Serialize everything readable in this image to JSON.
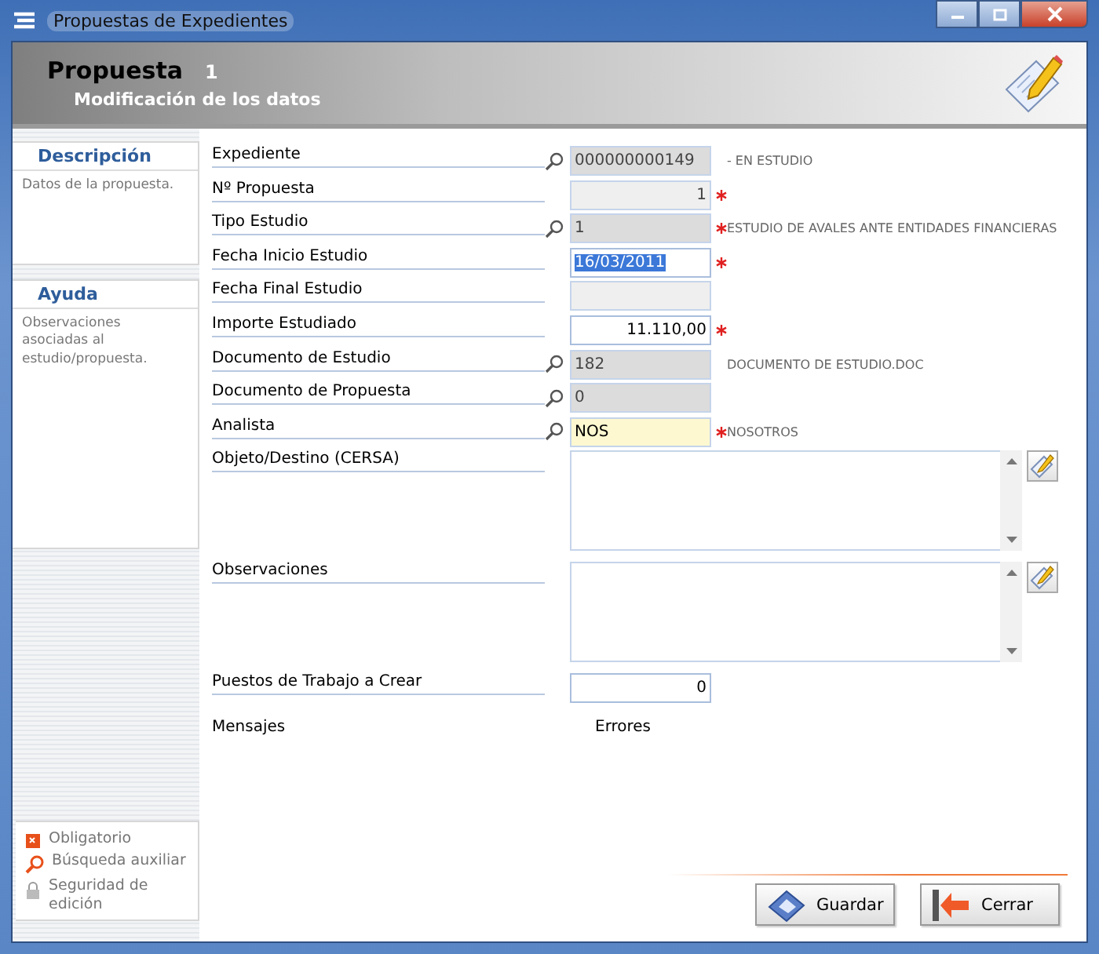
{
  "window": {
    "title": "Propuestas de Expedientes"
  },
  "header": {
    "title": "Propuesta",
    "number": "1",
    "subtitle": "Modificación de los datos"
  },
  "sidebar": {
    "panels": [
      {
        "title": "Descripción",
        "text": "Datos de la propuesta."
      },
      {
        "title": "Ayuda",
        "text": "Observaciones asociadas al estudio/propuesta."
      }
    ],
    "legend": [
      {
        "kind": "required",
        "label": "Obligatorio"
      },
      {
        "kind": "search",
        "label": "Búsqueda auxiliar"
      },
      {
        "kind": "lock",
        "label": "Seguridad de edición"
      }
    ]
  },
  "fields": [
    {
      "label": "Expediente",
      "kind": "readonly",
      "lookup": true,
      "value": "000000000149",
      "align_right": false,
      "required": false,
      "note": "- EN ESTUDIO"
    },
    {
      "label": "Nº Propuesta",
      "kind": "empty",
      "lookup": false,
      "value": "1",
      "align_right": true,
      "required": true
    },
    {
      "label": "Tipo Estudio",
      "kind": "readonly",
      "lookup": true,
      "value": "1",
      "align_right": false,
      "required": true,
      "note": "ESTUDIO DE AVALES ANTE ENTIDADES FINANCIERAS"
    },
    {
      "label": "Fecha Inicio Estudio",
      "kind": "focused",
      "lookup": false,
      "value": "16/03/2011",
      "align_right": false,
      "required": true
    },
    {
      "label": "Fecha Final Estudio",
      "kind": "empty",
      "lookup": false,
      "required": false
    },
    {
      "label": "Importe Estudiado",
      "kind": "input",
      "lookup": false,
      "value": "11.110,00",
      "align_right": true,
      "required": true
    },
    {
      "label": "Documento de Estudio",
      "kind": "readonly",
      "lookup": true,
      "value": "182",
      "align_right": false,
      "required": false,
      "note": "DOCUMENTO DE ESTUDIO.DOC"
    },
    {
      "label": "Documento de Propuesta",
      "kind": "readonly",
      "lookup": true,
      "value": "0",
      "align_right": false,
      "required": false
    },
    {
      "label": "Analista",
      "kind": "lookup",
      "lookup": true,
      "value": "NOS",
      "align_right": false,
      "required": true,
      "note": "NOSOTROS"
    },
    {
      "label": "Objeto/Destino (CERSA)",
      "kind": "textarea",
      "lookup": false
    },
    {
      "label": "Observaciones",
      "kind": "textarea",
      "lookup": false
    },
    {
      "label": "Puestos de Trabajo a Crear",
      "kind": "input",
      "lookup": false,
      "value": "0",
      "align_right": true,
      "required": false
    }
  ],
  "status_labels": [
    "Mensajes",
    "Errores"
  ],
  "buttons": [
    {
      "kind": "save",
      "label": "Guardar"
    },
    {
      "kind": "close",
      "label": "Cerrar"
    }
  ]
}
